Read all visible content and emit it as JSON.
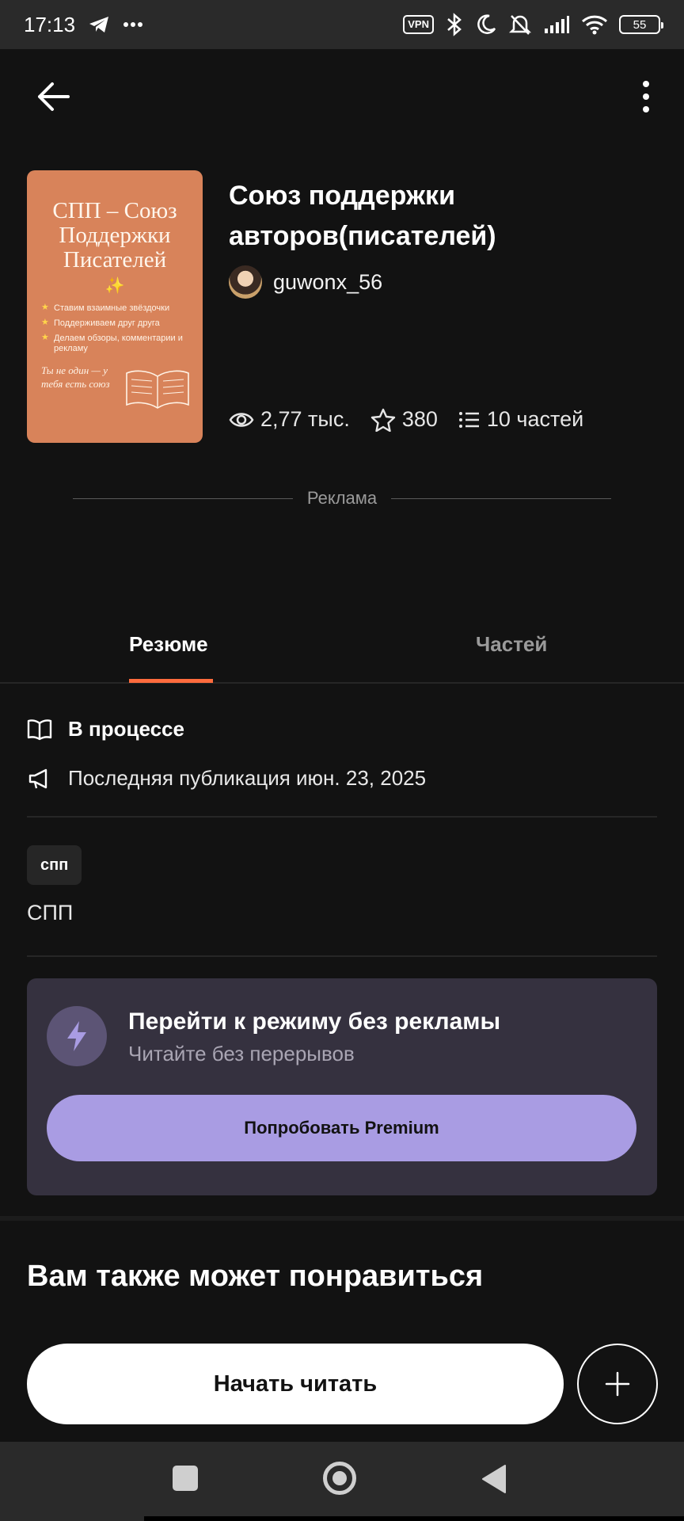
{
  "status_bar": {
    "time": "17:13",
    "vpn": "VPN",
    "battery": "55"
  },
  "book": {
    "title": "Союз поддержки авторов(писателей)",
    "author": "guwonx_56",
    "cover": {
      "title": "СПП – Союз Поддержки Писателей",
      "spark": "✨",
      "items": [
        "Ставим взаимные звёздочки",
        "Поддерживаем друг друга",
        "Делаем обзоры, комментарии и рекламу"
      ],
      "bottom": "Ты не один — у тебя есть союз"
    },
    "stats": {
      "views": "2,77 тыс.",
      "stars": "380",
      "parts": "10 частей"
    }
  },
  "ad": {
    "label": "Реклама"
  },
  "tabs": {
    "summary": "Резюме",
    "parts": "Частей"
  },
  "info": {
    "status": "В процессе",
    "last_published": "Последняя публикация июн. 23, 2025"
  },
  "tags": {
    "tag": "спп",
    "description": "СПП"
  },
  "premium": {
    "title": "Перейти к режиму без рекламы",
    "subtitle": "Читайте без перерывов",
    "button": "Попробовать Premium"
  },
  "recommendations": {
    "title": "Вам также может понравиться"
  },
  "actions": {
    "start_reading": "Начать читать"
  },
  "colors": {
    "background": "#121212",
    "accent": "#ff6b3d",
    "premium_button": "#a99ce3",
    "premium_card": "#35313f"
  }
}
